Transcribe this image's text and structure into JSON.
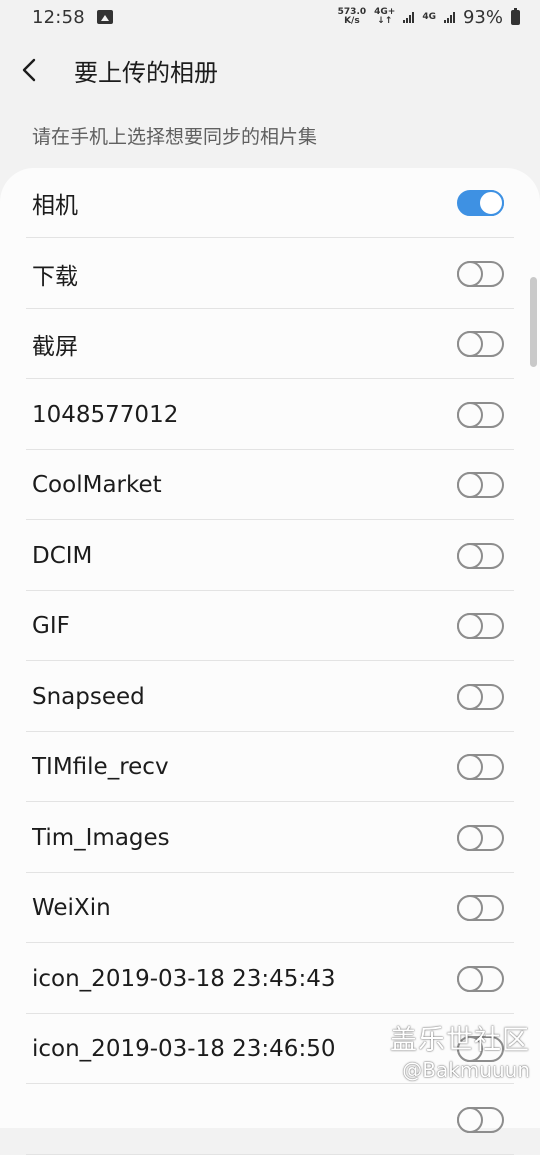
{
  "status_bar": {
    "time": "12:58",
    "net_speed_value": "573.0",
    "net_speed_unit": "K/s",
    "net_type_1": "4G+",
    "net_type_2": "4G",
    "battery_percent": "93%"
  },
  "header": {
    "title": "要上传的相册"
  },
  "section_label": "请在手机上选择想要同步的相片集",
  "albums": [
    {
      "name": "相机",
      "enabled": true
    },
    {
      "name": "下载",
      "enabled": false
    },
    {
      "name": "截屏",
      "enabled": false
    },
    {
      "name": "1048577012",
      "enabled": false
    },
    {
      "name": "CoolMarket",
      "enabled": false
    },
    {
      "name": "DCIM",
      "enabled": false
    },
    {
      "name": "GIF",
      "enabled": false
    },
    {
      "name": "Snapseed",
      "enabled": false
    },
    {
      "name": "TIMfile_recv",
      "enabled": false
    },
    {
      "name": "Tim_Images",
      "enabled": false
    },
    {
      "name": "WeiXin",
      "enabled": false
    },
    {
      "name": "icon_2019-03-18 23:45:43",
      "enabled": false
    },
    {
      "name": "icon_2019-03-18 23:46:50",
      "enabled": false
    },
    {
      "name": "",
      "enabled": false
    }
  ],
  "watermark": {
    "main": "盖乐世社区",
    "sub": "@Bakmuuun"
  },
  "colors": {
    "toggle_on": "#3e91e3",
    "toggle_off": "#8d8d8d",
    "background": "#f2f2f2",
    "card": "#fcfcfc"
  }
}
